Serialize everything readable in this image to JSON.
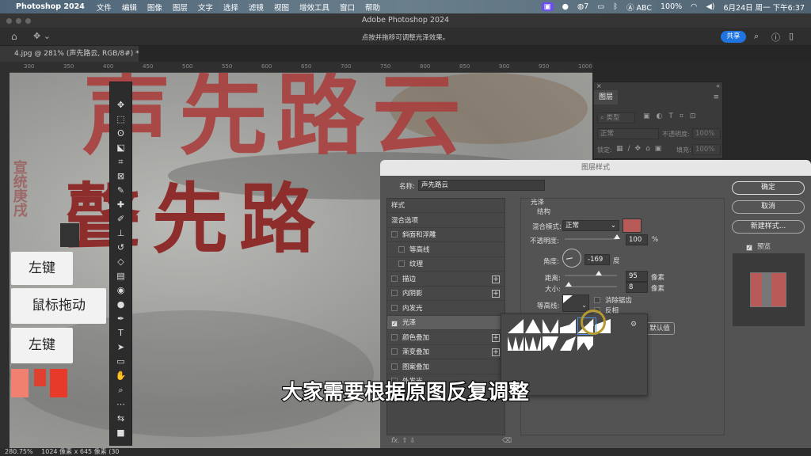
{
  "menubar": {
    "app": "Photoshop 2024",
    "items": [
      "文件",
      "编辑",
      "图像",
      "图层",
      "文字",
      "选择",
      "滤镜",
      "视图",
      "增效工具",
      "窗口",
      "帮助"
    ],
    "wechat_count": "7",
    "input": "ABC",
    "battery": "100%",
    "datetime": "6月24日 周一 下午6:37"
  },
  "window": {
    "title": "Adobe Photoshop 2024"
  },
  "options": {
    "hint": "点按并拖移可调整光泽效果。",
    "share": "共享"
  },
  "document": {
    "tab": "4.jpg @ 281% (声先路云, RGB/8#) *",
    "ruler_ticks": [
      "300",
      "350",
      "400",
      "450",
      "500",
      "550",
      "600",
      "650",
      "700",
      "750",
      "800",
      "850",
      "900",
      "950",
      "1000"
    ],
    "canvas_text_1": "声先路云",
    "canvas_text_2": "聲先路",
    "canvas_text_side": "宣统庚戌"
  },
  "overlay": {
    "keys": [
      "左键",
      "鼠标拖动",
      "左键"
    ],
    "swatches": [
      "#f08070",
      "#e04030",
      "#e83a28"
    ],
    "subtitle": "大家需要根据原图反复调整"
  },
  "layers_panel": {
    "tab": "图层",
    "search": "类型",
    "blend": "正常",
    "opacity_label": "不透明度:",
    "opacity": "100%",
    "lock_label": "锁定:",
    "fill_label": "填充:",
    "fill": "100%"
  },
  "dialog": {
    "title": "图层样式",
    "name_label": "名称:",
    "name_value": "声先路云",
    "styles": [
      {
        "label": "样式",
        "cb": null
      },
      {
        "label": "混合选项",
        "cb": null
      },
      {
        "label": "斜面和浮雕",
        "cb": false
      },
      {
        "label": "等高线",
        "cb": false,
        "indent": true
      },
      {
        "label": "纹理",
        "cb": false,
        "indent": true
      },
      {
        "label": "描边",
        "cb": false,
        "plus": true
      },
      {
        "label": "内阴影",
        "cb": false,
        "plus": true
      },
      {
        "label": "内发光",
        "cb": false
      },
      {
        "label": "光泽",
        "cb": true,
        "selected": true
      },
      {
        "label": "颜色叠加",
        "cb": false,
        "plus": true
      },
      {
        "label": "渐变叠加",
        "cb": false,
        "plus": true
      },
      {
        "label": "图案叠加",
        "cb": false
      },
      {
        "label": "外发光",
        "cb": false
      }
    ],
    "section": "光泽",
    "group": "结构",
    "blend_label": "混合模式:",
    "blend_value": "正常",
    "color": "#b85a58",
    "opacity_label": "不透明度:",
    "opacity": "100",
    "opacity_unit": "%",
    "opacity_pct": 100,
    "angle_label": "角度:",
    "angle": "-169",
    "angle_unit": "度",
    "distance_label": "距离:",
    "distance": "95",
    "distance_unit": "像素",
    "size_label": "大小:",
    "size": "8",
    "size_unit": "像素",
    "contour_label": "等高线:",
    "antialias": "消除锯齿",
    "invert": "反相",
    "default_btn": "默认值",
    "buttons": {
      "ok": "确定",
      "cancel": "取消",
      "new_style": "新建样式...",
      "preview": "预览"
    }
  },
  "status": {
    "zoom": "280.75%",
    "size": "1024 像素 x 645 像素 (30"
  }
}
